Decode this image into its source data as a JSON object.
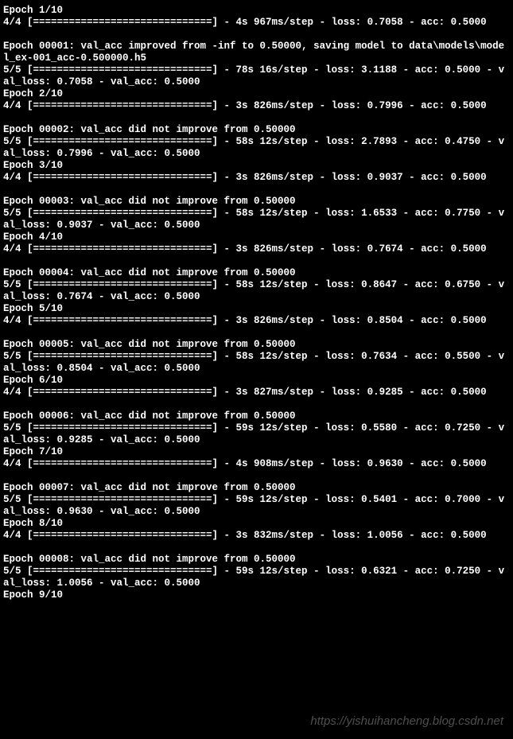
{
  "watermark": "https://yishuihancheng.blog.csdn.net",
  "prog44": "4/4 [==============================]",
  "prog55": "5/5 [==============================]",
  "lines": [
    {
      "t": "Epoch 1/10"
    },
    {
      "t": "@P44 - 4s 967ms/step - loss: 0.7058 - acc: 0.5000"
    },
    {
      "t": ""
    },
    {
      "t": "Epoch 00001: val_acc improved from -inf to 0.50000, saving model to data\\models\\model_ex-001_acc-0.500000.h5"
    },
    {
      "t": "@P55 - 78s 16s/step - loss: 3.1188 - acc: 0.5000 - val_loss: 0.7058 - val_acc: 0.5000"
    },
    {
      "t": "Epoch 2/10"
    },
    {
      "t": "@P44 - 3s 826ms/step - loss: 0.7996 - acc: 0.5000"
    },
    {
      "t": ""
    },
    {
      "t": "Epoch 00002: val_acc did not improve from 0.50000"
    },
    {
      "t": "@P55 - 58s 12s/step - loss: 2.7893 - acc: 0.4750 - val_loss: 0.7996 - val_acc: 0.5000"
    },
    {
      "t": "Epoch 3/10"
    },
    {
      "t": "@P44 - 3s 826ms/step - loss: 0.9037 - acc: 0.5000"
    },
    {
      "t": ""
    },
    {
      "t": "Epoch 00003: val_acc did not improve from 0.50000"
    },
    {
      "t": "@P55 - 58s 12s/step - loss: 1.6533 - acc: 0.7750 - val_loss: 0.9037 - val_acc: 0.5000"
    },
    {
      "t": "Epoch 4/10"
    },
    {
      "t": "@P44 - 3s 826ms/step - loss: 0.7674 - acc: 0.5000"
    },
    {
      "t": ""
    },
    {
      "t": "Epoch 00004: val_acc did not improve from 0.50000"
    },
    {
      "t": "@P55 - 58s 12s/step - loss: 0.8647 - acc: 0.6750 - val_loss: 0.7674 - val_acc: 0.5000"
    },
    {
      "t": "Epoch 5/10"
    },
    {
      "t": "@P44 - 3s 826ms/step - loss: 0.8504 - acc: 0.5000"
    },
    {
      "t": ""
    },
    {
      "t": "Epoch 00005: val_acc did not improve from 0.50000"
    },
    {
      "t": "@P55 - 58s 12s/step - loss: 0.7634 - acc: 0.5500 - val_loss: 0.8504 - val_acc: 0.5000"
    },
    {
      "t": "Epoch 6/10"
    },
    {
      "t": "@P44 - 3s 827ms/step - loss: 0.9285 - acc: 0.5000"
    },
    {
      "t": ""
    },
    {
      "t": "Epoch 00006: val_acc did not improve from 0.50000"
    },
    {
      "t": "@P55 - 59s 12s/step - loss: 0.5580 - acc: 0.7250 - val_loss: 0.9285 - val_acc: 0.5000"
    },
    {
      "t": "Epoch 7/10"
    },
    {
      "t": "@P44 - 4s 908ms/step - loss: 0.9630 - acc: 0.5000"
    },
    {
      "t": ""
    },
    {
      "t": "Epoch 00007: val_acc did not improve from 0.50000"
    },
    {
      "t": "@P55 - 59s 12s/step - loss: 0.5401 - acc: 0.7000 - val_loss: 0.9630 - val_acc: 0.5000"
    },
    {
      "t": "Epoch 8/10"
    },
    {
      "t": "@P44 - 3s 832ms/step - loss: 1.0056 - acc: 0.5000"
    },
    {
      "t": ""
    },
    {
      "t": "Epoch 00008: val_acc did not improve from 0.50000"
    },
    {
      "t": "@P55 - 59s 12s/step - loss: 0.6321 - acc: 0.7250 - val_loss: 1.0056 - val_acc: 0.5000"
    },
    {
      "t": "Epoch 9/10"
    }
  ]
}
